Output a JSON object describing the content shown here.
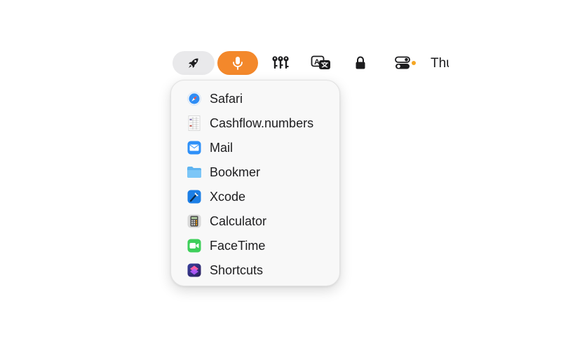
{
  "menubar": {
    "items": [
      {
        "icon": "rocket-icon",
        "active": true,
        "bg": "#e9e9eb"
      },
      {
        "icon": "microphone-icon",
        "active": true,
        "bg": "#f3882b"
      },
      {
        "icon": "keys-icon"
      },
      {
        "icon": "translate-icon"
      },
      {
        "icon": "lock-icon"
      },
      {
        "icon": "control-center-icon",
        "indicator_color": "#f5a623"
      }
    ],
    "clock_text": "Thu"
  },
  "menu": {
    "items": [
      {
        "label": "Safari",
        "icon": "safari-icon"
      },
      {
        "label": "Cashflow.numbers",
        "icon": "numbers-document-icon"
      },
      {
        "label": "Mail",
        "icon": "mail-icon"
      },
      {
        "label": "Bookmer",
        "icon": "folder-icon"
      },
      {
        "label": "Xcode",
        "icon": "xcode-icon"
      },
      {
        "label": "Calculator",
        "icon": "calculator-icon"
      },
      {
        "label": "FaceTime",
        "icon": "facetime-icon"
      },
      {
        "label": "Shortcuts",
        "icon": "shortcuts-icon"
      }
    ]
  }
}
